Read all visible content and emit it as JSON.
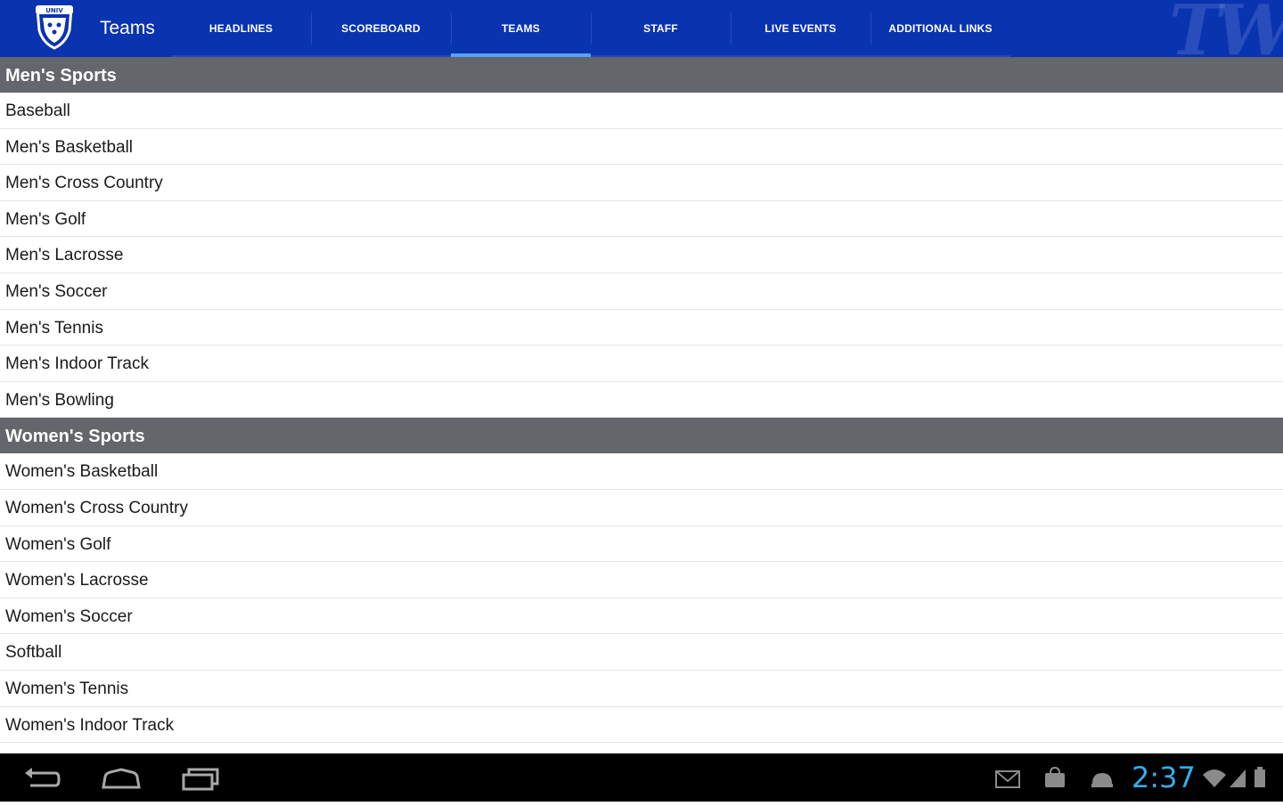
{
  "app": {
    "title": "Teams",
    "logo_icon": "school-crest-logo",
    "watermark_icon": "tw-watermark"
  },
  "tabs": [
    {
      "label": "HEADLINES",
      "selected": false
    },
    {
      "label": "SCOREBOARD",
      "selected": false
    },
    {
      "label": "TEAMS",
      "selected": true
    },
    {
      "label": "STAFF",
      "selected": false
    },
    {
      "label": "LIVE EVENTS",
      "selected": false
    },
    {
      "label": "ADDITIONAL LINKS",
      "selected": false
    }
  ],
  "sections": [
    {
      "title": "Men's Sports",
      "items": [
        "Baseball",
        "Men's Basketball",
        "Men's Cross Country",
        "Men's Golf",
        "Men's Lacrosse",
        "Men's Soccer",
        "Men's Tennis",
        "Men's Indoor Track",
        "Men's Bowling"
      ]
    },
    {
      "title": "Women's Sports",
      "items": [
        "Women's Basketball",
        "Women's Cross Country",
        "Women's Golf",
        "Women's Lacrosse",
        "Women's Soccer",
        "Softball",
        "Women's Tennis",
        "Women's Indoor Track"
      ]
    }
  ],
  "system_bar": {
    "time": "2:37",
    "nav_icons": [
      "back-icon",
      "home-icon",
      "recent-apps-icon"
    ],
    "status_icons": [
      "gmail-notification-icon",
      "market-notification-icon",
      "android-notification-icon",
      "wifi-icon",
      "signal-icon",
      "battery-icon"
    ]
  },
  "colors": {
    "action_bar": "#0a33b0",
    "tab_indicator": "#5aa0ff",
    "section_header": "#63666a",
    "clock": "#2fb0e8"
  }
}
